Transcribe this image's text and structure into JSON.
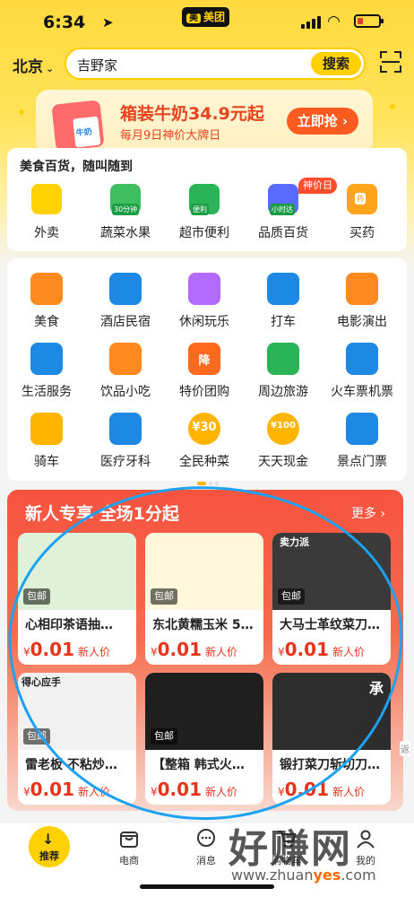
{
  "status_bar": {
    "time": "6:34",
    "app_badge": "美团"
  },
  "search": {
    "city": "北京",
    "query": "吉野家",
    "button": "搜索"
  },
  "banner": {
    "title": "箱装牛奶34.9元起",
    "subtitle": "每月9日神价大牌日",
    "button": "立即抢 ›",
    "milk_label": "牛奶"
  },
  "section1": {
    "title": "美食百货，随叫随到",
    "hot_badge": "神价日",
    "items": [
      {
        "label": "外卖",
        "icon": "kangaroo-icon",
        "color": "#ffd100"
      },
      {
        "label": "蔬菜水果",
        "icon": "vegetable-basket-icon",
        "tag": "30分钟",
        "color": "#3ec060"
      },
      {
        "label": "超市便利",
        "icon": "supermarket-basket-icon",
        "tag": "便利",
        "color": "#2ab457"
      },
      {
        "label": "品质百货",
        "icon": "phone-bag-icon",
        "tag": "小时达",
        "color": "#5c6bff"
      },
      {
        "label": "买药",
        "icon": "medicine-box-icon",
        "tag": "药",
        "color": "#ffa41b"
      }
    ]
  },
  "grid": {
    "items": [
      {
        "label": "美食",
        "icon": "fork-knife-icon",
        "color": "#ff8a1f"
      },
      {
        "label": "酒店民宿",
        "icon": "hotel-building-icon",
        "color": "#1e88e5"
      },
      {
        "label": "休闲玩乐",
        "icon": "leisure-icon",
        "color": "#b36bff"
      },
      {
        "label": "打车",
        "icon": "car-icon",
        "color": "#1e88e5"
      },
      {
        "label": "电影演出",
        "icon": "cat-face-icon",
        "color": "#ff8a1f"
      },
      {
        "label": "生活服务",
        "icon": "broom-icon",
        "color": "#1e88e5"
      },
      {
        "label": "饮品小吃",
        "icon": "drink-cup-icon",
        "color": "#ff8a1f"
      },
      {
        "label": "特价团购",
        "icon": "discount-arrow-icon",
        "color": "#ff6a1f",
        "glyph": "降"
      },
      {
        "label": "周边旅游",
        "icon": "palm-tree-icon",
        "color": "#2ab457"
      },
      {
        "label": "火车票机票",
        "icon": "airplane-icon",
        "color": "#1e88e5"
      },
      {
        "label": "骑车",
        "icon": "bicycle-icon",
        "color": "#ffb400"
      },
      {
        "label": "医疗牙科",
        "icon": "medical-cross-icon",
        "color": "#1e88e5"
      },
      {
        "label": "全民种菜",
        "icon": "sunflower-icon",
        "color": "#ffb400",
        "glyph": "¥30"
      },
      {
        "label": "天天现金",
        "icon": "coin-icon",
        "color": "#ffb400",
        "glyph": "¥100"
      },
      {
        "label": "景点门票",
        "icon": "temple-icon",
        "color": "#1e88e5"
      }
    ]
  },
  "newcomer": {
    "title": "新人专享 全场1分起",
    "more": "更多 ›",
    "products": [
      {
        "name": "心相印茶语抽…",
        "badge": "包邮",
        "currency": "¥",
        "price": "0.01",
        "tag": "新人价",
        "image_color": "#dff1d8"
      },
      {
        "name": "东北黄糯玉米 5…",
        "badge": "包邮",
        "currency": "¥",
        "price": "0.01",
        "tag": "新人价",
        "image_color": "#fff7dc"
      },
      {
        "name": "大马士革纹菜刀…",
        "badge": "包邮",
        "currency": "¥",
        "price": "0.01",
        "tag": "新人价",
        "image_color": "#3a3a3a"
      },
      {
        "name": "雷老板 不粘炒…",
        "badge": "包邮",
        "currency": "¥",
        "price": "0.01",
        "tag": "新人价",
        "image_color": "#f1f1f1"
      },
      {
        "name": "【整箱 韩式火…",
        "badge": "包邮",
        "currency": "¥",
        "price": "0.01",
        "tag": "新人价",
        "image_color": "#1f1f1f"
      },
      {
        "name": "锻打菜刀斩切刀…",
        "badge": "",
        "currency": "¥",
        "price": "0.01",
        "tag": "新人价",
        "image_color": "#2d2d2d"
      }
    ],
    "product_overlays": [
      "卖力派",
      "得心应手",
      "承"
    ]
  },
  "bottom_nav": {
    "items": [
      {
        "label": "推荐",
        "icon": "down-arrow-icon"
      },
      {
        "label": "电商",
        "icon": "shopping-bag-icon"
      },
      {
        "label": "消息",
        "icon": "chat-bubble-icon"
      },
      {
        "label": "购物车",
        "icon": "cart-icon"
      },
      {
        "label": "我的",
        "icon": "user-icon"
      }
    ]
  },
  "watermark": {
    "text": "好赚网",
    "url_prefix": "www.zhuan",
    "url_highlight": "yes",
    "url_suffix": ".com"
  },
  "side_tag": "返"
}
